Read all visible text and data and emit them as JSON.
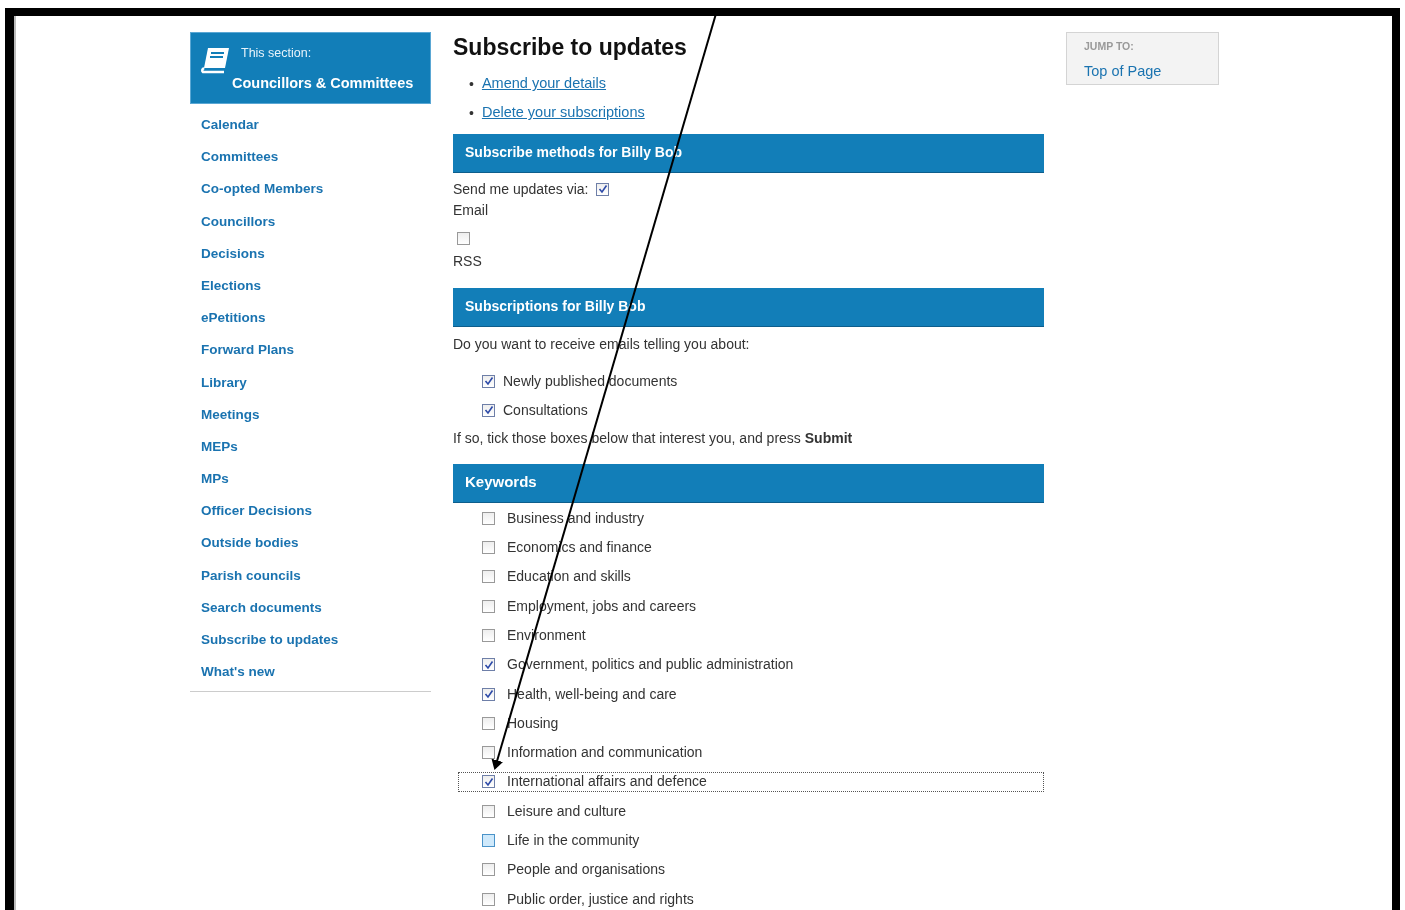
{
  "section": {
    "caption": "This section:",
    "title": "Councillors & Committees"
  },
  "sidebar": {
    "items": [
      {
        "label": "Calendar"
      },
      {
        "label": "Committees"
      },
      {
        "label": "Co-opted Members"
      },
      {
        "label": "Councillors"
      },
      {
        "label": "Decisions"
      },
      {
        "label": "Elections"
      },
      {
        "label": "ePetitions"
      },
      {
        "label": "Forward Plans"
      },
      {
        "label": "Library"
      },
      {
        "label": "Meetings"
      },
      {
        "label": "MEPs"
      },
      {
        "label": "MPs"
      },
      {
        "label": "Officer Decisions"
      },
      {
        "label": "Outside bodies"
      },
      {
        "label": "Parish councils"
      },
      {
        "label": "Search documents"
      },
      {
        "label": "Subscribe to updates"
      },
      {
        "label": "What's new"
      }
    ]
  },
  "main": {
    "title": "Subscribe to updates",
    "links": [
      {
        "bullet": "•",
        "label": "Amend your details"
      },
      {
        "bullet": "•",
        "label": "Delete your subscriptions"
      }
    ],
    "methods": {
      "heading": "Subscribe methods for Billy Bob",
      "prompt": "Send me updates via:",
      "options": [
        {
          "label": "Email",
          "checked": true
        },
        {
          "label": "RSS",
          "checked": false
        }
      ]
    },
    "subscriptions": {
      "heading": "Subscriptions for Billy Bob",
      "question": "Do you want to receive emails telling you about:",
      "options": [
        {
          "label": "Newly published documents",
          "checked": true
        },
        {
          "label": "Consultations",
          "checked": true
        }
      ],
      "instruction": "If so, tick those boxes below that interest you, and press **Submit**"
    },
    "keywords": {
      "heading": "Keywords",
      "items": [
        {
          "label": "Business and industry",
          "checked": false,
          "focused": false,
          "hovered": false
        },
        {
          "label": "Economics and finance",
          "checked": false,
          "focused": false,
          "hovered": false
        },
        {
          "label": "Education and skills",
          "checked": false,
          "focused": false,
          "hovered": false
        },
        {
          "label": "Employment, jobs and careers",
          "checked": false,
          "focused": false,
          "hovered": false
        },
        {
          "label": "Environment",
          "checked": false,
          "focused": false,
          "hovered": false
        },
        {
          "label": "Government, politics and public administration",
          "checked": true,
          "focused": false,
          "hovered": false
        },
        {
          "label": "Health, well-being and care",
          "checked": true,
          "focused": false,
          "hovered": false
        },
        {
          "label": "Housing",
          "checked": false,
          "focused": false,
          "hovered": false
        },
        {
          "label": "Information and communication",
          "checked": false,
          "focused": false,
          "hovered": false
        },
        {
          "label": "International affairs and defence",
          "checked": true,
          "focused": true,
          "hovered": false
        },
        {
          "label": "Leisure and culture",
          "checked": false,
          "focused": false,
          "hovered": false
        },
        {
          "label": "Life in the community",
          "checked": false,
          "focused": false,
          "hovered": true
        },
        {
          "label": "People and organisations",
          "checked": false,
          "focused": false,
          "hovered": false
        },
        {
          "label": "Public order, justice and rights",
          "checked": false,
          "focused": false,
          "hovered": false
        }
      ]
    }
  },
  "jump": {
    "heading": "JUMP TO:",
    "link": "Top of Page"
  }
}
